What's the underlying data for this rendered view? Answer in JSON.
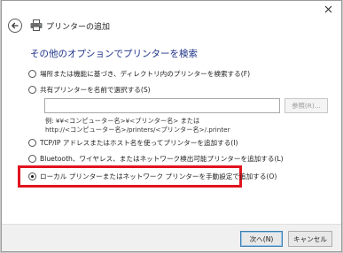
{
  "window": {
    "title": "プリンターの追加"
  },
  "heading": "その他のオプションでプリンターを検索",
  "options": [
    {
      "label": "場所または機能に基づき、ディレクトリ内のプリンターを検索する(F)",
      "checked": false
    },
    {
      "label": "共有プリンターを名前で選択する(S)",
      "checked": false
    },
    {
      "label": "TCP/IP アドレスまたはホスト名を使ってプリンターを追加する(I)",
      "checked": false
    },
    {
      "label": "Bluetooth、ワイヤレス、またはネットワーク検出可能プリンターを追加する(L)",
      "checked": false
    },
    {
      "label": "ローカル プリンターまたはネットワーク プリンターを手動設定で追加する(O)",
      "checked": true
    }
  ],
  "shared_printer": {
    "input_value": "",
    "browse_label": "参照(R)...",
    "example_line1": "例: ¥¥<コンピューター名>¥<プリンター名> または",
    "example_line2": "http://<コンピューター名>/printers/<プリンター名>/.printer"
  },
  "footer": {
    "next_label": "次へ(N)",
    "cancel_label": "キャンセル"
  },
  "colors": {
    "heading": "#1e3287",
    "highlight": "#e0141e",
    "primary_button_border": "#3c7fb1"
  }
}
